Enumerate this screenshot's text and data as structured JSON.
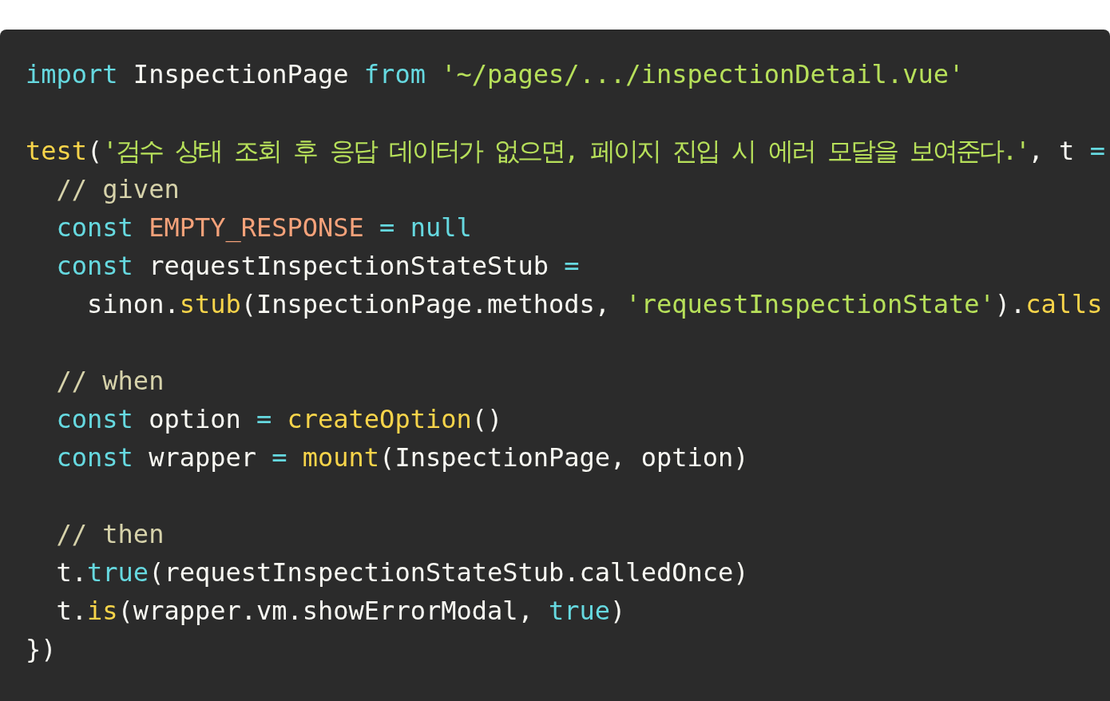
{
  "code_lines": [
    {
      "kind": "code",
      "tokens": [
        {
          "kind": "keyword",
          "text": "import"
        },
        {
          "kind": "plain",
          "text": " InspectionPage "
        },
        {
          "kind": "keyword",
          "text": "from"
        },
        {
          "kind": "string",
          "text": " '~/pages/.../inspectionDetail.vue'"
        }
      ]
    },
    {
      "kind": "blank"
    },
    {
      "kind": "code",
      "tokens": [
        {
          "kind": "function",
          "text": "test"
        },
        {
          "kind": "plain",
          "text": "("
        },
        {
          "kind": "string",
          "text": "'검수 상태 조회 후 응답 데이터가 없으면, 페이지 진입 시 에러 모달을 보여준다.'"
        },
        {
          "kind": "plain",
          "text": ", t "
        },
        {
          "kind": "keyword",
          "text": "="
        }
      ]
    },
    {
      "kind": "code",
      "tokens": [
        {
          "kind": "comment",
          "text": "  // given"
        }
      ]
    },
    {
      "kind": "code",
      "tokens": [
        {
          "kind": "keyword",
          "text": "  const"
        },
        {
          "kind": "constant",
          "text": " EMPTY_RESPONSE "
        },
        {
          "kind": "keyword",
          "text": "= null"
        }
      ]
    },
    {
      "kind": "code",
      "tokens": [
        {
          "kind": "keyword",
          "text": "  const"
        },
        {
          "kind": "plain",
          "text": " requestInspectionStateStub "
        },
        {
          "kind": "keyword",
          "text": "="
        }
      ]
    },
    {
      "kind": "code",
      "tokens": [
        {
          "kind": "plain",
          "text": "    sinon."
        },
        {
          "kind": "function",
          "text": "stub"
        },
        {
          "kind": "plain",
          "text": "(InspectionPage.methods, "
        },
        {
          "kind": "string",
          "text": "'requestInspectionState'"
        },
        {
          "kind": "plain",
          "text": ")."
        },
        {
          "kind": "function",
          "text": "calls"
        }
      ]
    },
    {
      "kind": "blank"
    },
    {
      "kind": "code",
      "tokens": [
        {
          "kind": "comment",
          "text": "  // when"
        }
      ]
    },
    {
      "kind": "code",
      "tokens": [
        {
          "kind": "keyword",
          "text": "  const"
        },
        {
          "kind": "plain",
          "text": " option "
        },
        {
          "kind": "keyword",
          "text": "="
        },
        {
          "kind": "function",
          "text": " createOption"
        },
        {
          "kind": "plain",
          "text": "()"
        }
      ]
    },
    {
      "kind": "code",
      "tokens": [
        {
          "kind": "keyword",
          "text": "  const"
        },
        {
          "kind": "plain",
          "text": " wrapper "
        },
        {
          "kind": "keyword",
          "text": "="
        },
        {
          "kind": "function",
          "text": " mount"
        },
        {
          "kind": "plain",
          "text": "(InspectionPage, option)"
        }
      ]
    },
    {
      "kind": "blank"
    },
    {
      "kind": "code",
      "tokens": [
        {
          "kind": "comment",
          "text": "  // then"
        }
      ]
    },
    {
      "kind": "code",
      "tokens": [
        {
          "kind": "plain",
          "text": "  t."
        },
        {
          "kind": "keyword",
          "text": "true"
        },
        {
          "kind": "plain",
          "text": "(requestInspectionStateStub.calledOnce)"
        }
      ]
    },
    {
      "kind": "code",
      "tokens": [
        {
          "kind": "plain",
          "text": "  t."
        },
        {
          "kind": "function",
          "text": "is"
        },
        {
          "kind": "plain",
          "text": "(wrapper.vm.showErrorModal, "
        },
        {
          "kind": "keyword",
          "text": "true"
        },
        {
          "kind": "plain",
          "text": ")"
        }
      ]
    },
    {
      "kind": "code",
      "tokens": [
        {
          "kind": "plain",
          "text": "})"
        }
      ]
    }
  ]
}
